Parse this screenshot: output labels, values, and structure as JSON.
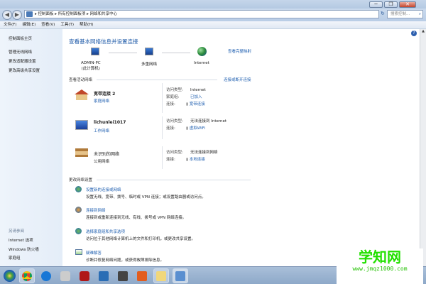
{
  "window": {
    "minimize": "─",
    "restore": "❐",
    "close": "✕"
  },
  "address": {
    "breadcrumbs": [
      "控制面板",
      "所有控制面板项",
      "网络和共享中心"
    ],
    "separator": "▸",
    "search_placeholder": "搜索控制..."
  },
  "menu": [
    "文件(F)",
    "编辑(E)",
    "查看(V)",
    "工具(T)",
    "帮助(H)"
  ],
  "sidebar": {
    "home": "控制面板主页",
    "items": [
      "管理无线网络",
      "更改适配器设置",
      "更改高级共享设置"
    ],
    "see_also_title": "另请参阅",
    "see_also": [
      "Internet 选项",
      "Windows 防火墙",
      "家庭组"
    ]
  },
  "main": {
    "title": "查看基本网络信息并设置连接",
    "full_map": "查看完整映射",
    "map": {
      "computer": "ADMIN-PC",
      "computer_sub": "(此计算机)",
      "multi": "多重网络",
      "internet": "Internet"
    },
    "active_title": "查看活动网络",
    "connect_link": "连接或断开连接",
    "networks": [
      {
        "name": "宽带连接 2",
        "type": "家庭网络",
        "type_link": true,
        "rows": [
          {
            "k": "访问类型:",
            "v": "Internet",
            "link": false
          },
          {
            "k": "家庭组:",
            "v": "已加入",
            "link": true
          },
          {
            "k": "连接:",
            "v": "宽带连接",
            "link": true
          }
        ]
      },
      {
        "name": "lichunlei1017",
        "type": "工作网络",
        "type_link": true,
        "rows": [
          {
            "k": "访问类型:",
            "v": "无法连接到 Internet",
            "link": false
          },
          {
            "k": "连接:",
            "v": "虚拟WiFi",
            "link": true
          }
        ]
      },
      {
        "name": "未识别的网络",
        "type": "公用网络",
        "type_link": false,
        "rows": [
          {
            "k": "访问类型:",
            "v": "无法连接到网络",
            "link": false
          },
          {
            "k": "连接:",
            "v": "本地连接",
            "link": true
          }
        ]
      }
    ],
    "change_title": "更改网络设置",
    "tasks": [
      {
        "title": "设置新的连接或网络",
        "desc": "设置无线、宽带、拨号、临时或 VPN 连接；或设置路由器或访问点。"
      },
      {
        "title": "连接到网络",
        "desc": "连接到或重新连接到无线、有线、拨号或 VPN 网络连接。"
      },
      {
        "title": "选择家庭组和共享选项",
        "desc": "访问位于其他网络计算机上的文件和打印机，或更改共享设置。"
      },
      {
        "title": "疑难解答",
        "desc": "诊断并修复网络问题，或获得故障排除信息。"
      }
    ]
  },
  "watermark": {
    "brand": "学知网",
    "url": "www.jmqz1000.com"
  },
  "taskbar": {
    "apps": [
      "chrome",
      "sogou",
      "app",
      "media",
      "store",
      "office",
      "folder",
      "control-panel"
    ]
  }
}
